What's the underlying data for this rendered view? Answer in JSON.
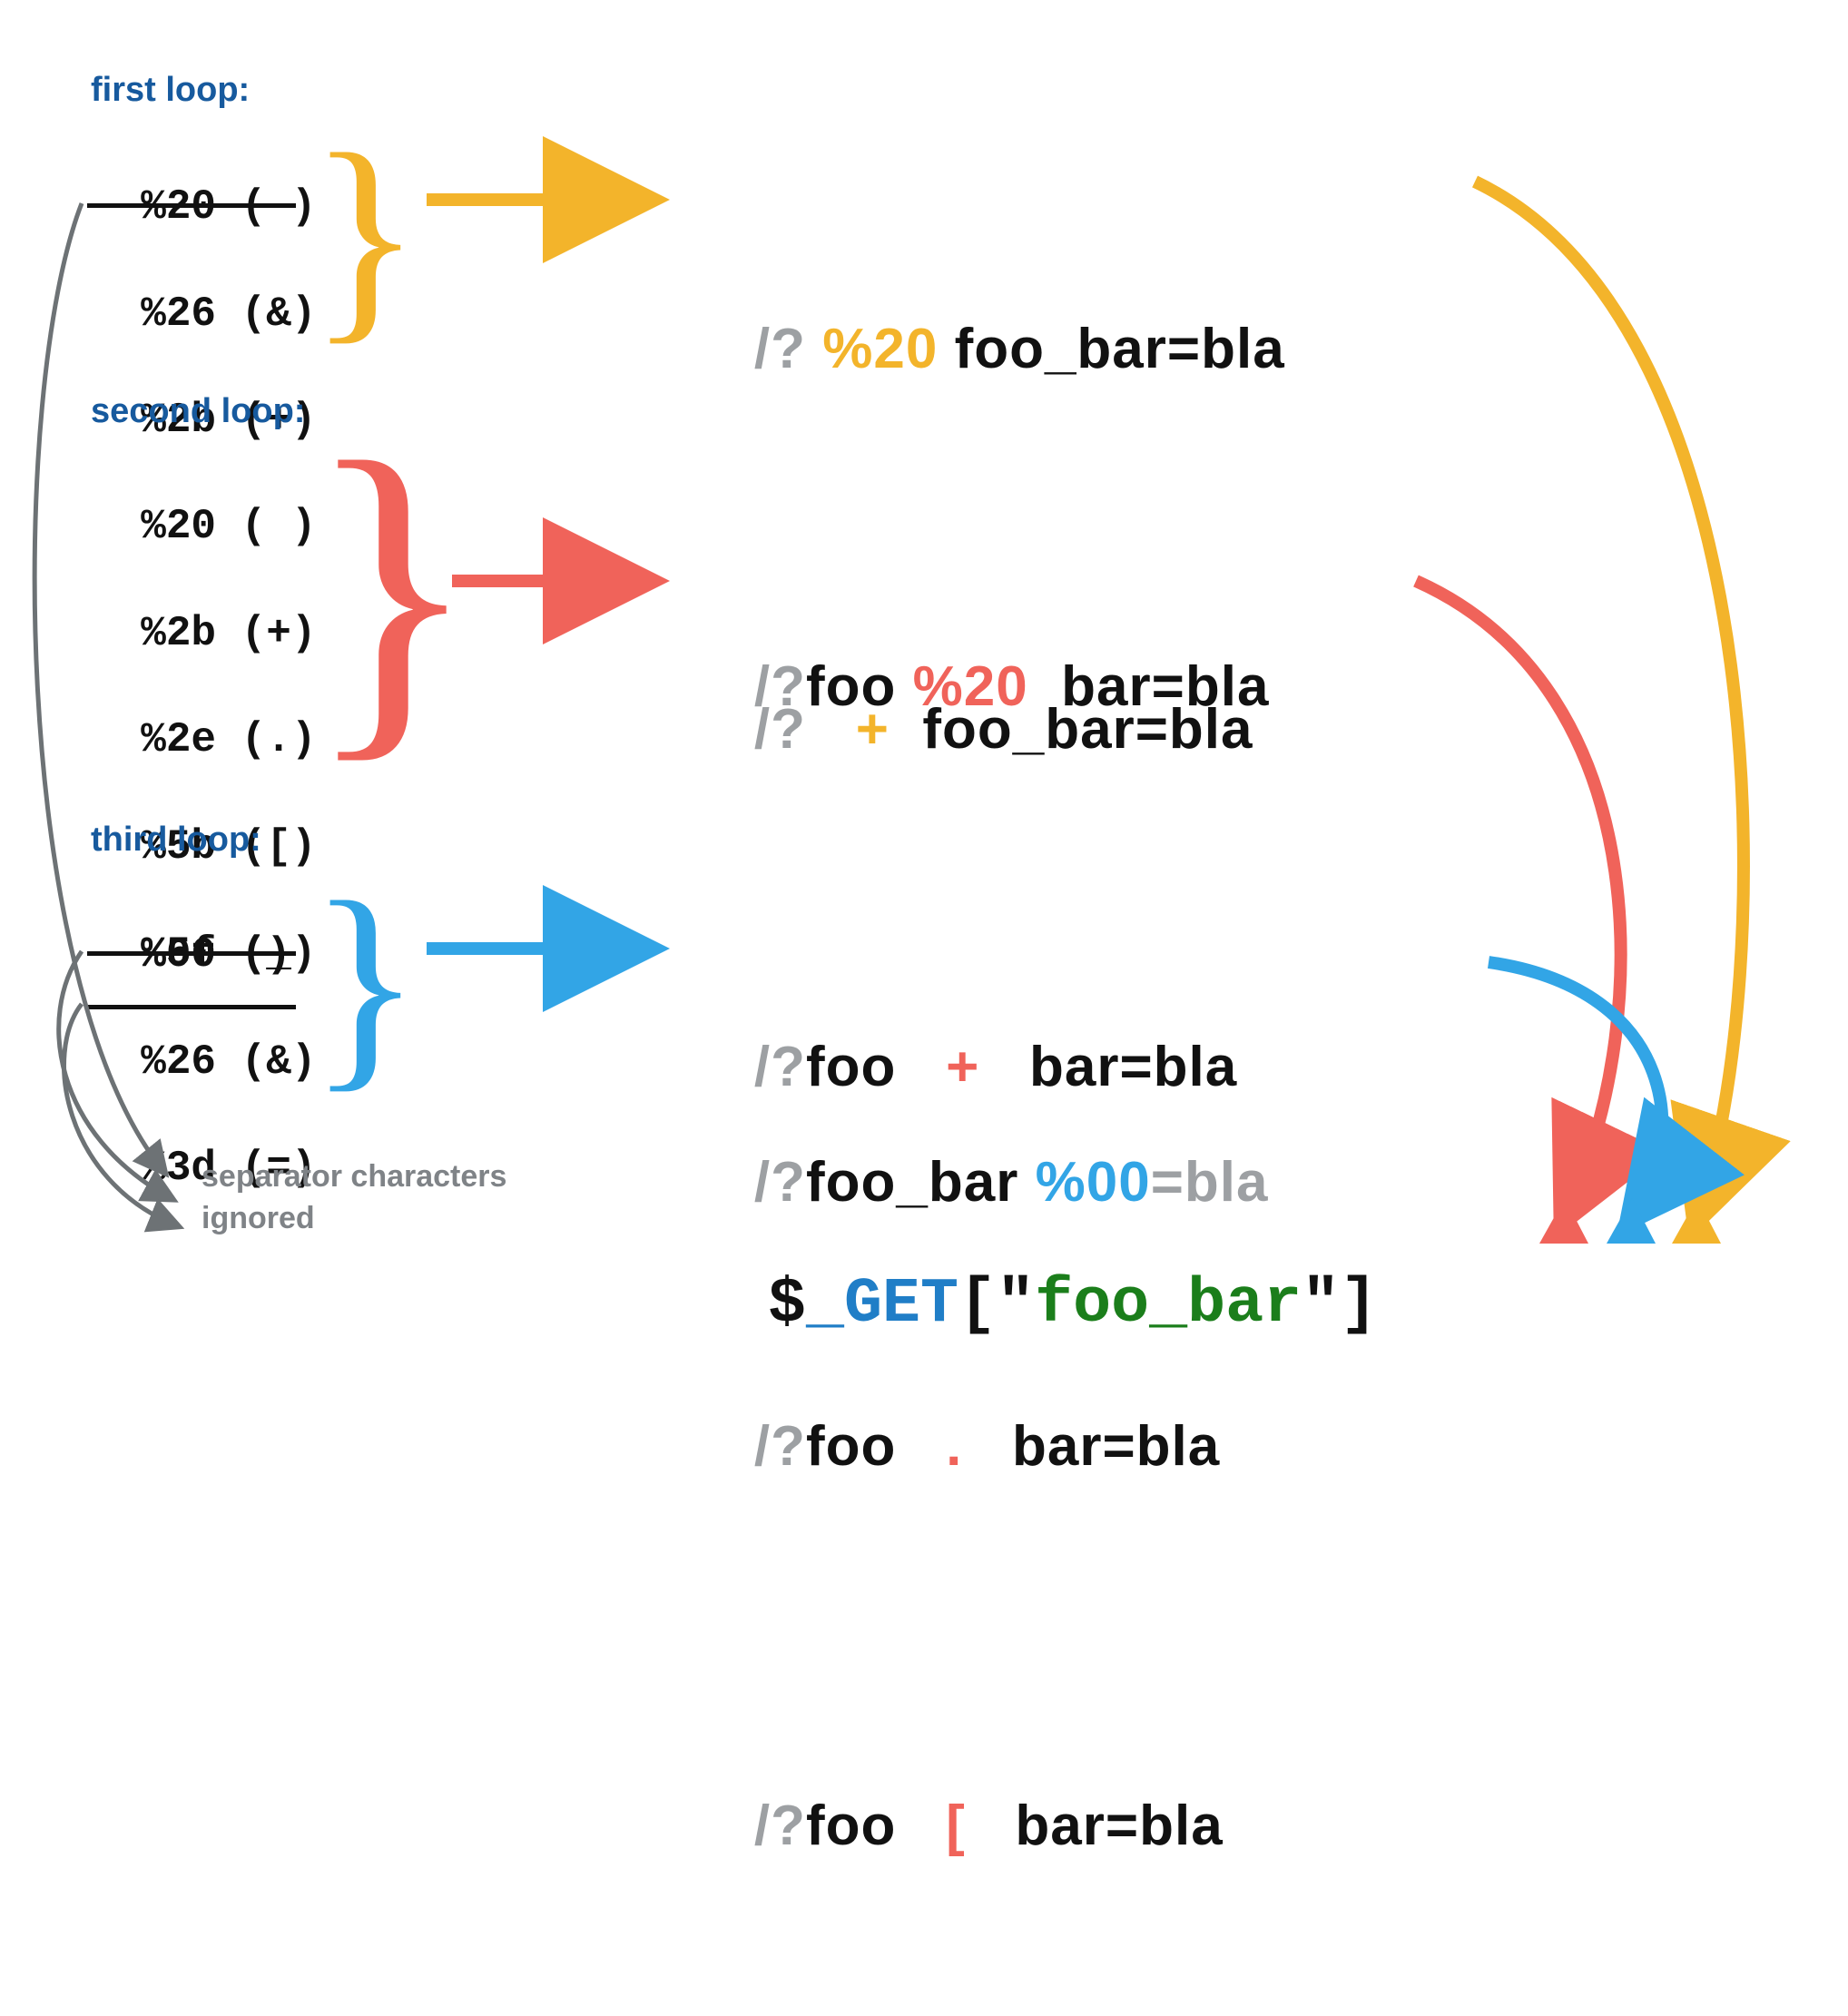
{
  "loops": {
    "first": {
      "label": "first loop:",
      "items": [
        "%20 ( )",
        "%26 (&)",
        "%2b (+)"
      ],
      "struck": [
        1
      ]
    },
    "second": {
      "label": "second loop:",
      "items": [
        "%20 ( )",
        "%2b (+)",
        "%2e (.)",
        "%5b ([)",
        "%5f (_)"
      ],
      "struck": []
    },
    "third": {
      "label": "third loop:",
      "items": [
        "%00 ()",
        "%26 (&)",
        "%3d (=)"
      ],
      "struck": [
        1,
        2
      ]
    }
  },
  "examples": {
    "first": [
      {
        "pre": "/?",
        "mid": " %20 ",
        "post": "foo_bar=bla"
      },
      {
        "pre": "/?",
        "mid": "   +  ",
        "post": "foo_bar=bla"
      }
    ],
    "second": [
      {
        "pre": "/?foo",
        "mid": " %20 ",
        "post": " bar=bla"
      },
      {
        "pre": "/?foo",
        "mid": "   +  ",
        "post": " bar=bla"
      },
      {
        "pre": "/?foo",
        "mid": "   .  ",
        "post": " bar=bla"
      },
      {
        "pre": "/?foo",
        "mid": "   [  ",
        "post": " bar=bla"
      }
    ],
    "third": [
      {
        "pre": "/?foo_bar",
        "mid": " %00",
        "post": "=bla"
      }
    ]
  },
  "captions": {
    "separator_line1": "separator characters",
    "separator_line2": "ignored"
  },
  "result": {
    "dollar": "$",
    "underscore_get": "_GET",
    "open": "[\"",
    "key": "foo_bar",
    "close": "\"]"
  },
  "colors": {
    "yellow": "#f3b42b",
    "red": "#f0635a",
    "cyan": "#32a5e6",
    "gray": "#9da0a3",
    "darkgray": "#6d7275"
  }
}
